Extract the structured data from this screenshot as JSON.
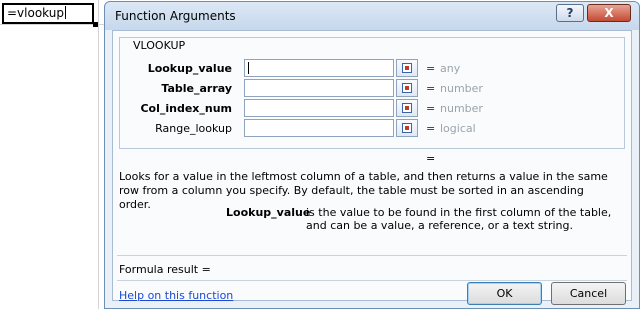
{
  "sheet": {
    "cell_text": "=vlookup"
  },
  "dialog": {
    "title": "Function Arguments",
    "help_button_label": "?",
    "close_button_label": "X",
    "function_name": "VLOOKUP",
    "arguments": [
      {
        "label": "Lookup_value",
        "value": "",
        "bold": true,
        "result_hint": "any"
      },
      {
        "label": "Table_array",
        "value": "",
        "bold": true,
        "result_hint": "number"
      },
      {
        "label": "Col_index_num",
        "value": "",
        "bold": true,
        "result_hint": "number"
      },
      {
        "label": "Range_lookup",
        "value": "",
        "bold": false,
        "result_hint": "logical"
      }
    ],
    "equals_sign": "=",
    "result_equals": "=",
    "description": "Looks for a value in the leftmost column of a table, and then returns a value in the same row from a column you specify. By default, the table must be sorted in an ascending order.",
    "arg_help_name": "Lookup_value",
    "arg_help_text": "is the value to be found in the first column of the table, and can be a value, a reference, or a text string.",
    "formula_result_label": "Formula result =",
    "help_link": "Help on this function",
    "ok_label": "OK",
    "cancel_label": "Cancel"
  }
}
